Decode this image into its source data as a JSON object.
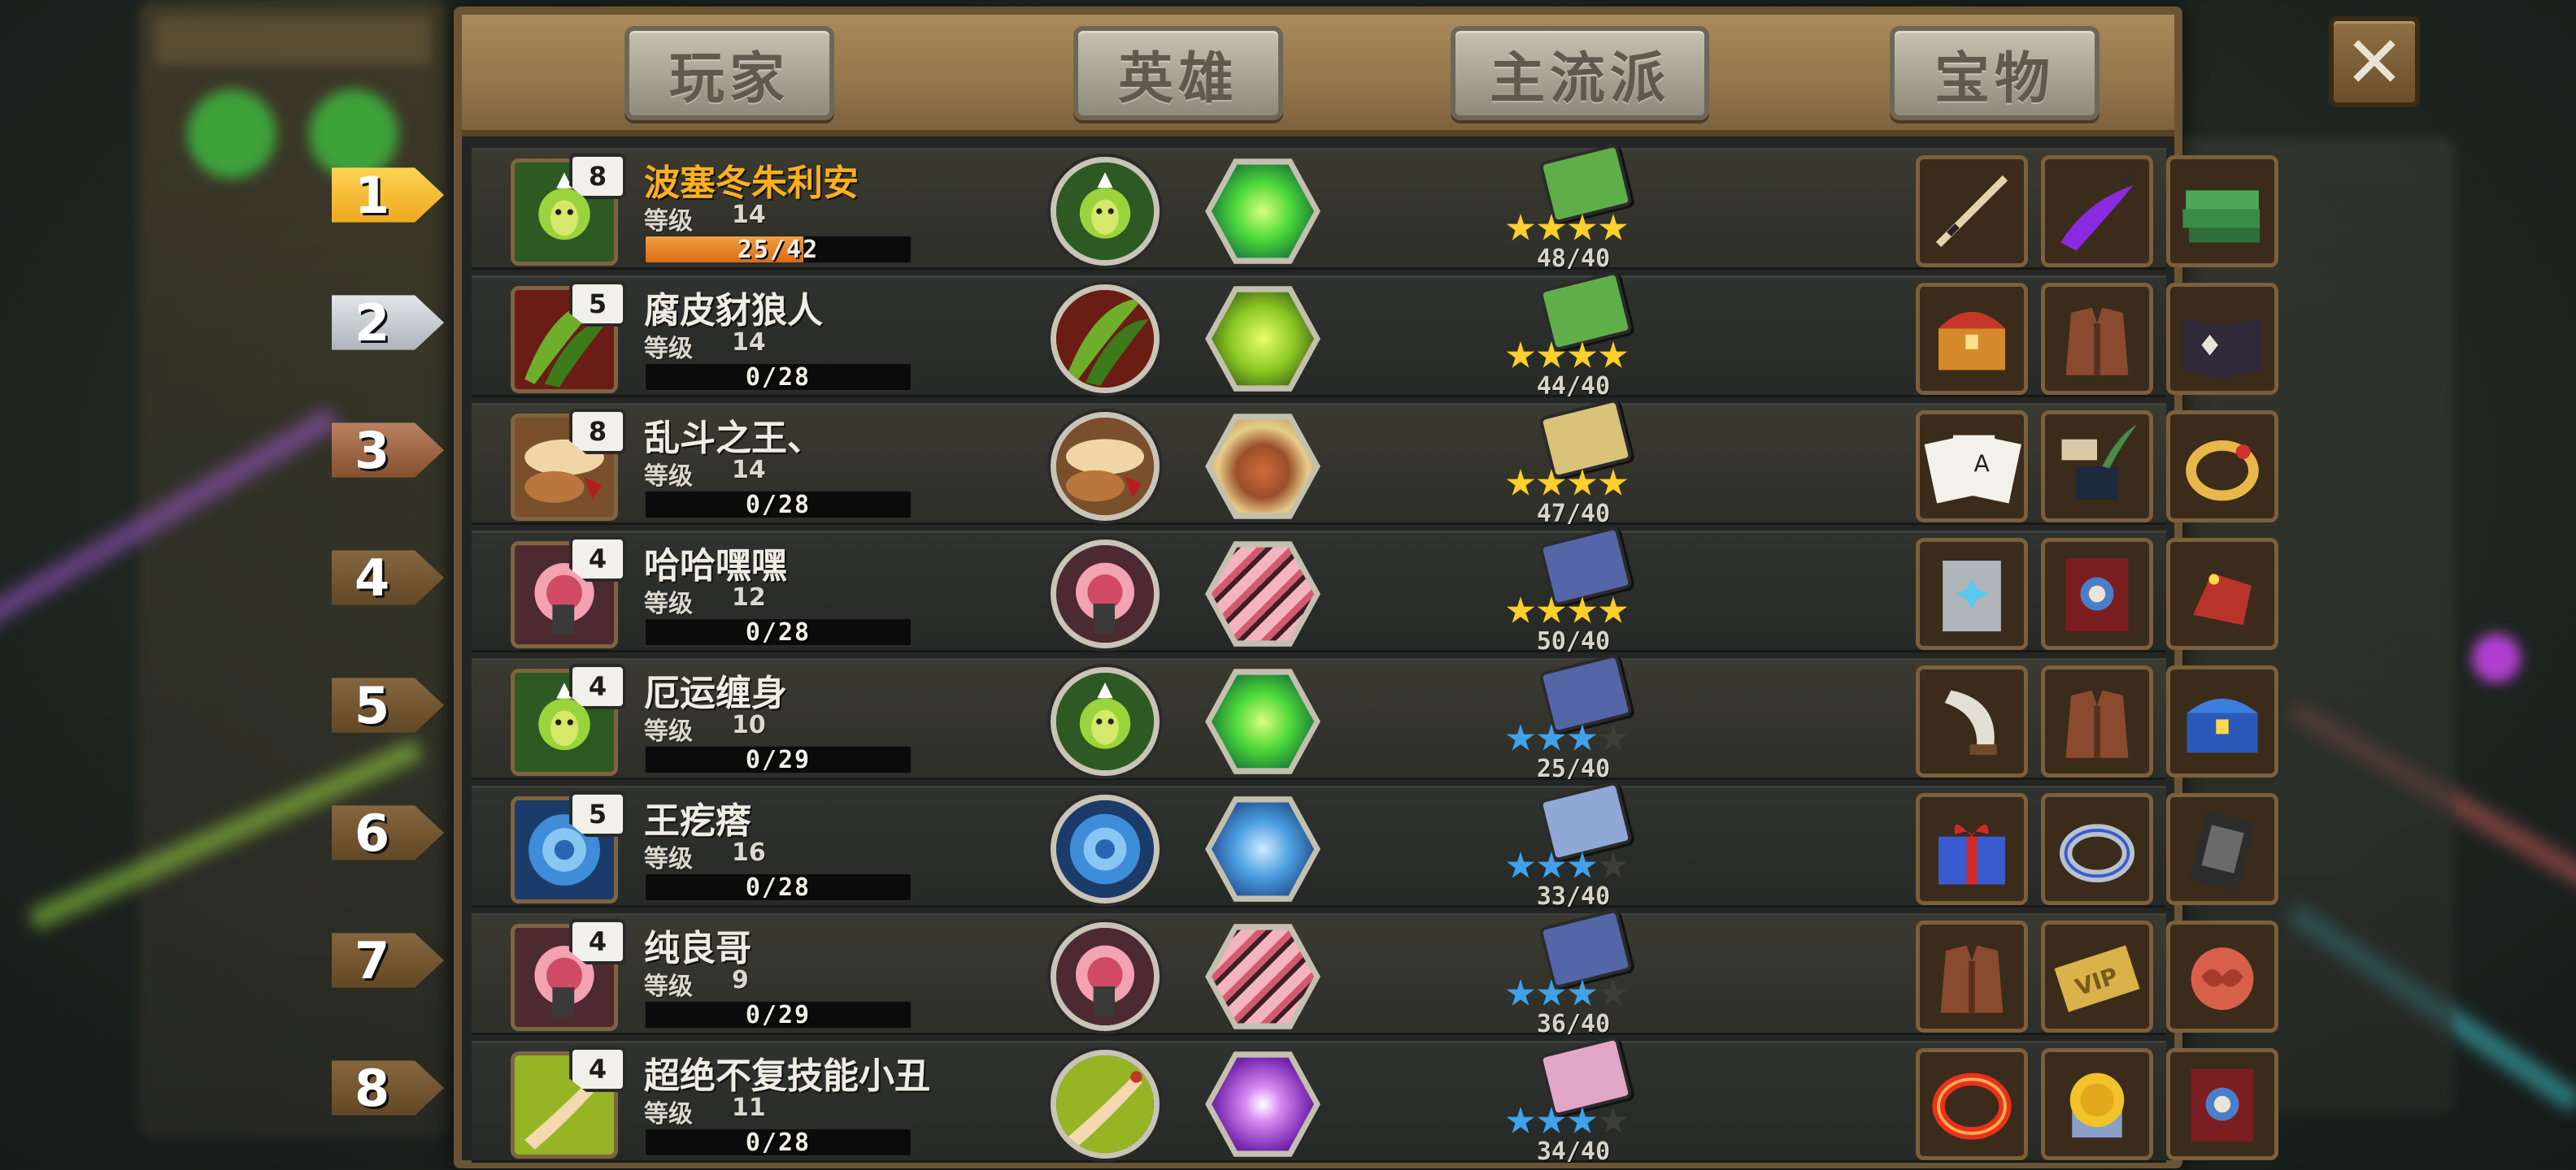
{
  "tabs": [
    {
      "label": "玩家"
    },
    {
      "label": "英雄"
    },
    {
      "label": "主流派"
    },
    {
      "label": "宝物"
    }
  ],
  "close_icon": "close-x-icon",
  "level_label": "等级",
  "rows": [
    {
      "rank": "1",
      "badge": "8",
      "name": "波塞冬朱利安",
      "level": "14",
      "xp": "25/42",
      "xp_fraction": 0.595,
      "score": "48/40",
      "stars": 4,
      "star_color": "gold",
      "book_color": "#5fae4a",
      "hero": "green-wizard",
      "skill": "green-burst"
    },
    {
      "rank": "2",
      "badge": "5",
      "name": "腐皮豺狼人",
      "level": "14",
      "xp": "0/28",
      "xp_fraction": 0,
      "score": "44/40",
      "stars": 4,
      "star_color": "gold",
      "book_color": "#5fae4a",
      "hero": "green-red-claws",
      "skill": "lime-splash"
    },
    {
      "rank": "3",
      "badge": "8",
      "name": "乱斗之王、",
      "level": "14",
      "xp": "0/28",
      "xp_fraction": 0,
      "score": "47/40",
      "stars": 4,
      "star_color": "gold",
      "book_color": "#d9c37a",
      "hero": "brown-swirl",
      "skill": "acorn"
    },
    {
      "rank": "4",
      "badge": "4",
      "name": "哈哈嘿嘿",
      "level": "12",
      "xp": "0/28",
      "xp_fraction": 0,
      "score": "50/40",
      "stars": 4,
      "star_color": "gold",
      "book_color": "#5566a8",
      "hero": "pink-vortex",
      "skill": "pink-slash"
    },
    {
      "rank": "5",
      "badge": "4",
      "name": "厄运缠身",
      "level": "10",
      "xp": "0/29",
      "xp_fraction": 0,
      "score": "25/40",
      "stars": 3,
      "star_color": "blue",
      "book_color": "#5566a8",
      "hero": "green-wizard",
      "skill": "green-burst"
    },
    {
      "rank": "6",
      "badge": "5",
      "name": "王疙瘩",
      "level": "16",
      "xp": "0/28",
      "xp_fraction": 0,
      "score": "33/40",
      "stars": 3,
      "star_color": "blue",
      "book_color": "#8fa8d6",
      "hero": "blue-vortex",
      "skill": "blue-vortex"
    },
    {
      "rank": "7",
      "badge": "4",
      "name": "纯良哥",
      "level": "9",
      "xp": "0/29",
      "xp_fraction": 0,
      "score": "36/40",
      "stars": 3,
      "star_color": "blue",
      "book_color": "#5566a8",
      "hero": "pink-vortex",
      "skill": "pink-slash"
    },
    {
      "rank": "8",
      "badge": "4",
      "name": "超绝不复技能小丑",
      "level": "11",
      "xp": "0/28",
      "xp_fraction": 0,
      "score": "34/40",
      "stars": 3,
      "star_color": "blue",
      "book_color": "#e2a6c8",
      "hero": "lime-hand",
      "skill": "purple-sparkle"
    }
  ],
  "treasures": [
    [
      "spear",
      "purple-blade",
      "green-books"
    ],
    [
      "treasure-chest",
      "leather-vest",
      "spellbook-dark"
    ],
    [
      "playing-cards",
      "ink-pot",
      "gold-ring"
    ],
    [
      "silver-tome",
      "red-tome",
      "red-gauntlet"
    ],
    [
      "horn",
      "leather-vest",
      "blue-chest"
    ],
    [
      "gift-box",
      "silver-ring",
      "dark-card"
    ],
    [
      "leather-vest",
      "vip-card",
      "red-brain"
    ],
    [
      "fire-ring",
      "gold-coin",
      "red-tome"
    ]
  ]
}
